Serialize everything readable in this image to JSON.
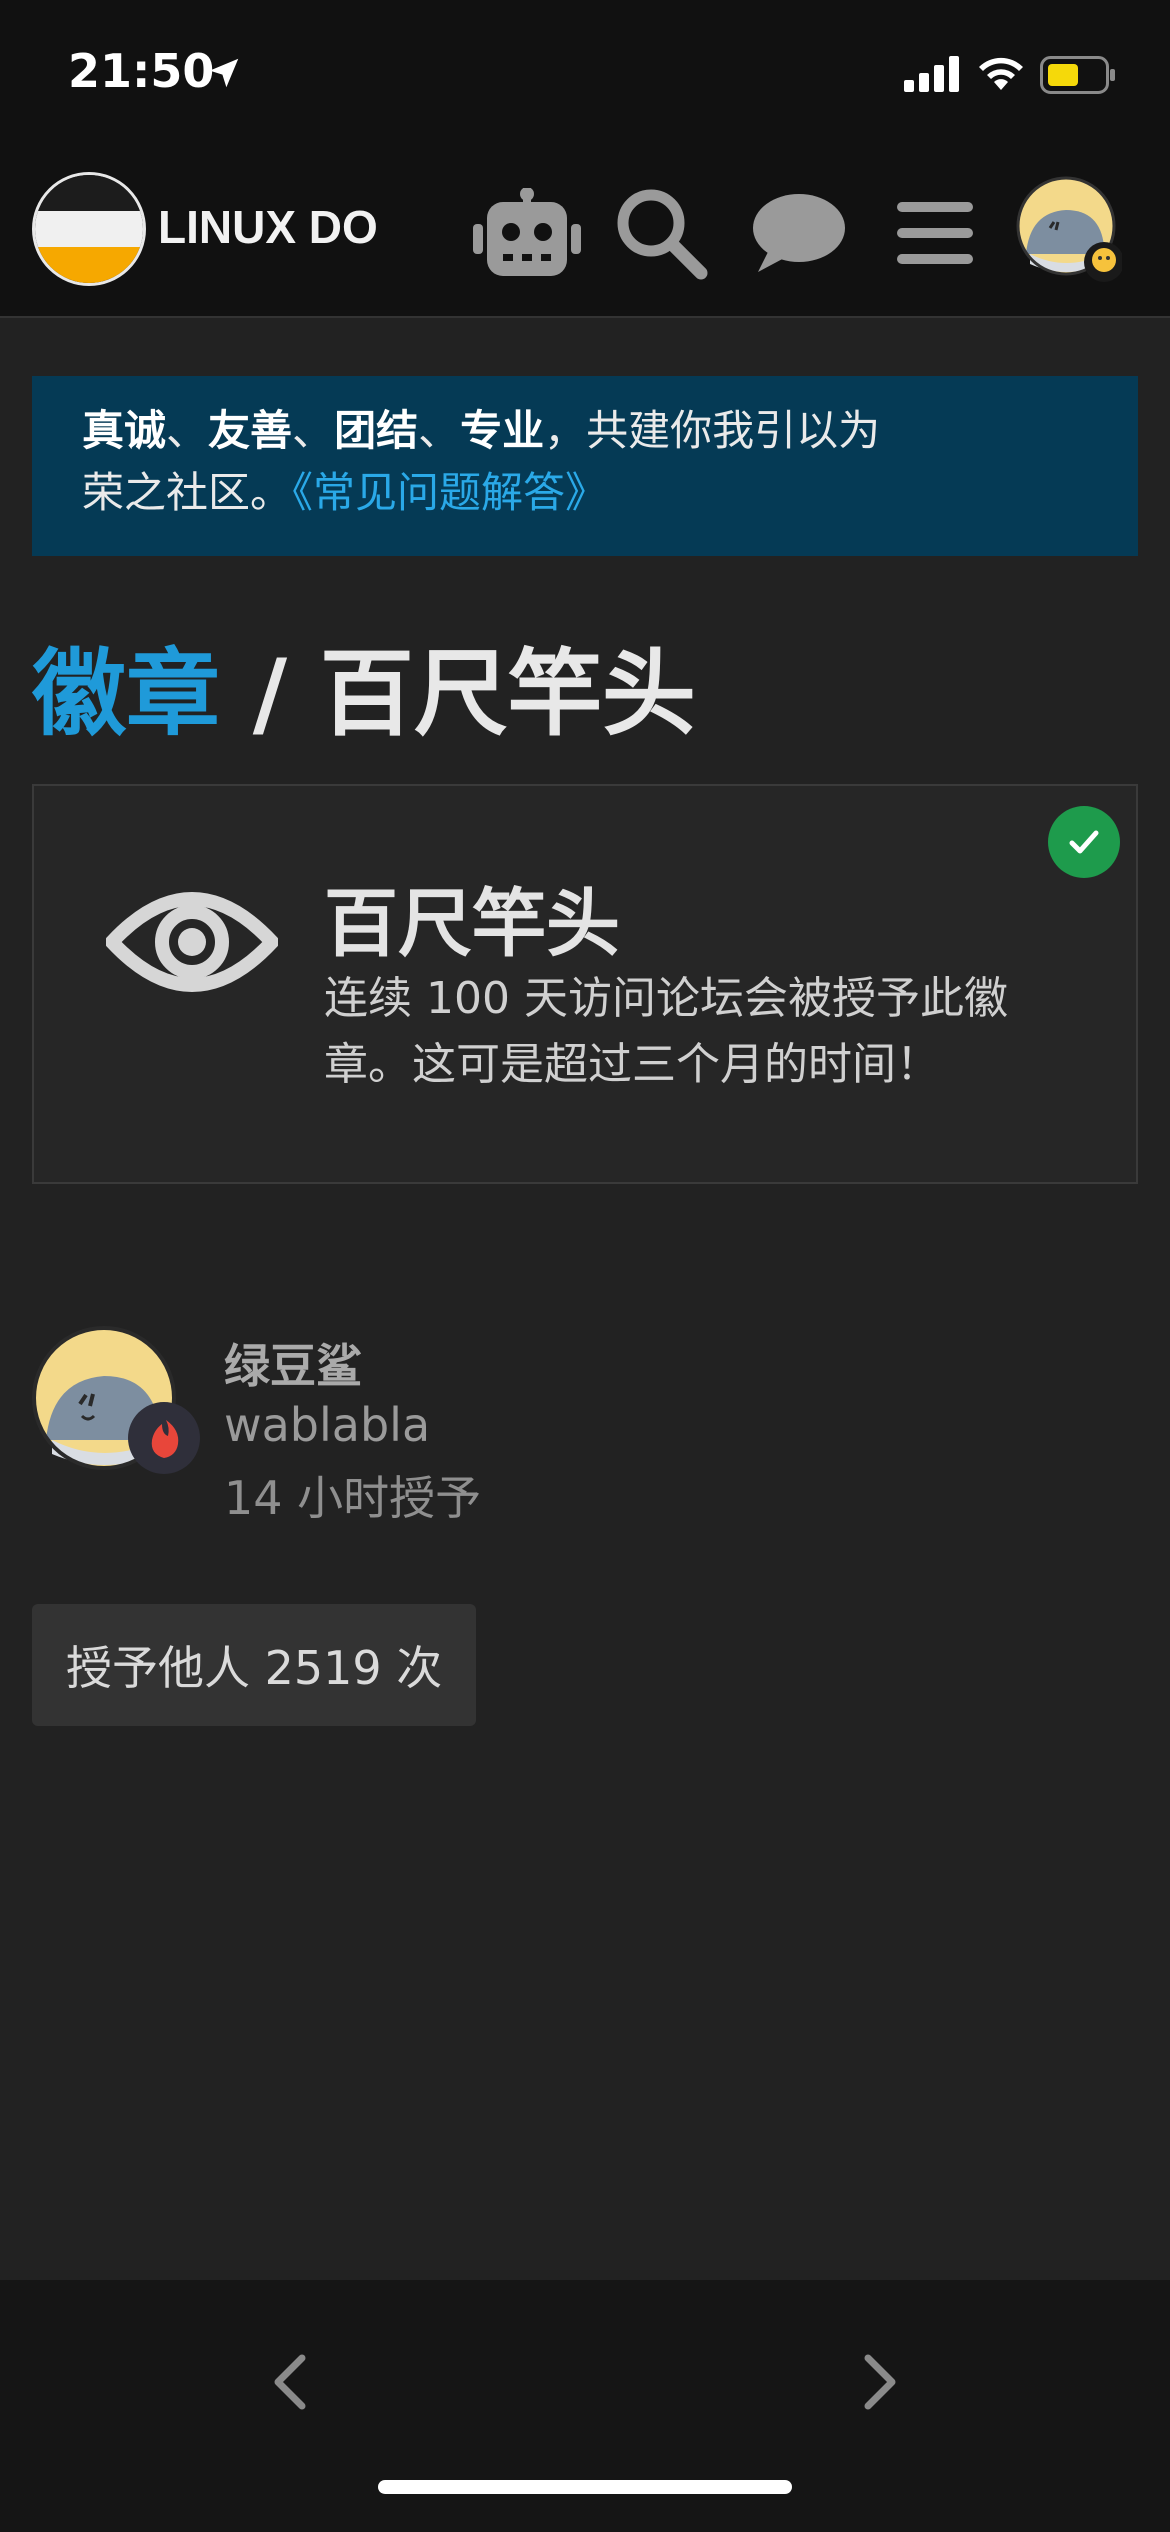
{
  "status_bar": {
    "time": "21:50",
    "battery_color": "#f5d90a"
  },
  "header": {
    "site_name": "LINUX DO",
    "icons": [
      "robot-icon",
      "search-icon",
      "chat-icon",
      "hamburger-menu-icon",
      "user-avatar"
    ]
  },
  "banner": {
    "values": [
      "真诚",
      "友善",
      "团结",
      "专业"
    ],
    "sep": "、",
    "comma": "，",
    "text_line1": "共建你我引以为",
    "text_line2": "荣之社区。",
    "faq_link": "《常见问题解答》"
  },
  "page": {
    "breadcrumb": "徽章",
    "separator": "/",
    "title": "百尺竿头"
  },
  "badge": {
    "name": "百尺竿头",
    "description": "连续 100 天访问论坛会被授予此徽章。这可是超过三个月的时间！",
    "icon": "eye-icon",
    "granted": true
  },
  "grantee": {
    "display_name": "绿豆鲨",
    "username": "wablabla",
    "granted_at": "14 小时授予"
  },
  "grant_count_label": "授予他人 2519 次",
  "colors": {
    "accent": "#1f9ad9",
    "banner_bg": "#053a55",
    "check_green": "#1e9b4c",
    "page_bg": "#222222"
  }
}
